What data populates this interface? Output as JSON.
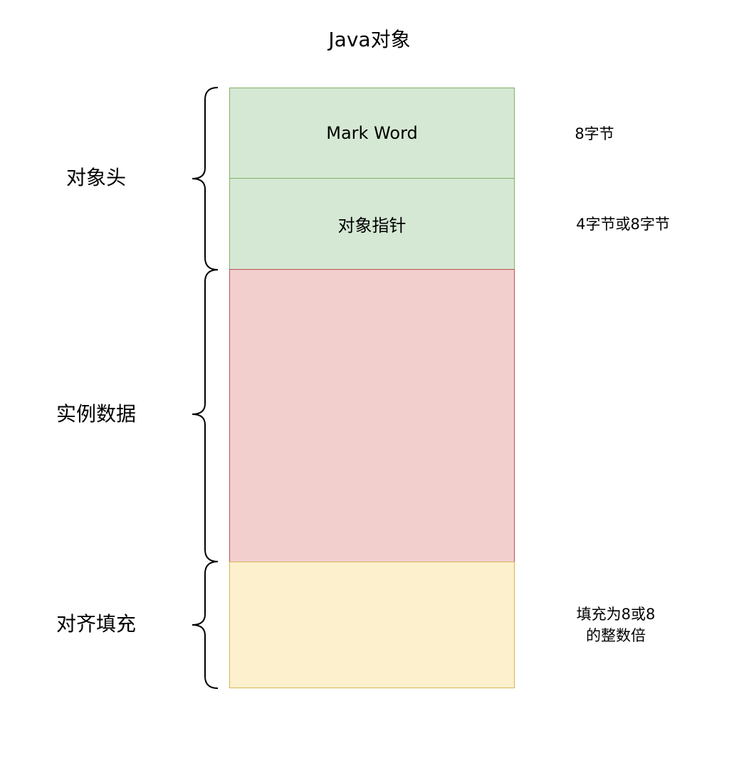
{
  "title": "Java对象",
  "boxes": {
    "mark_word": "Mark Word",
    "object_pointer": "对象指针",
    "instance_data": "",
    "padding": ""
  },
  "groups": {
    "header": "对象头",
    "instance": "实例数据",
    "padding": "对齐填充"
  },
  "notes": {
    "mark_word_size": "8字节",
    "pointer_size": "4字节或8字节",
    "padding_line1": "填充为8或8",
    "padding_line2": "的整数倍"
  },
  "colors": {
    "green_fill": "#d5e8d4",
    "green_border": "#82b366",
    "red_fill": "#f2cfcd",
    "red_border": "#b85450",
    "yellow_fill": "#fdf0cd",
    "yellow_border": "#d6b656"
  }
}
